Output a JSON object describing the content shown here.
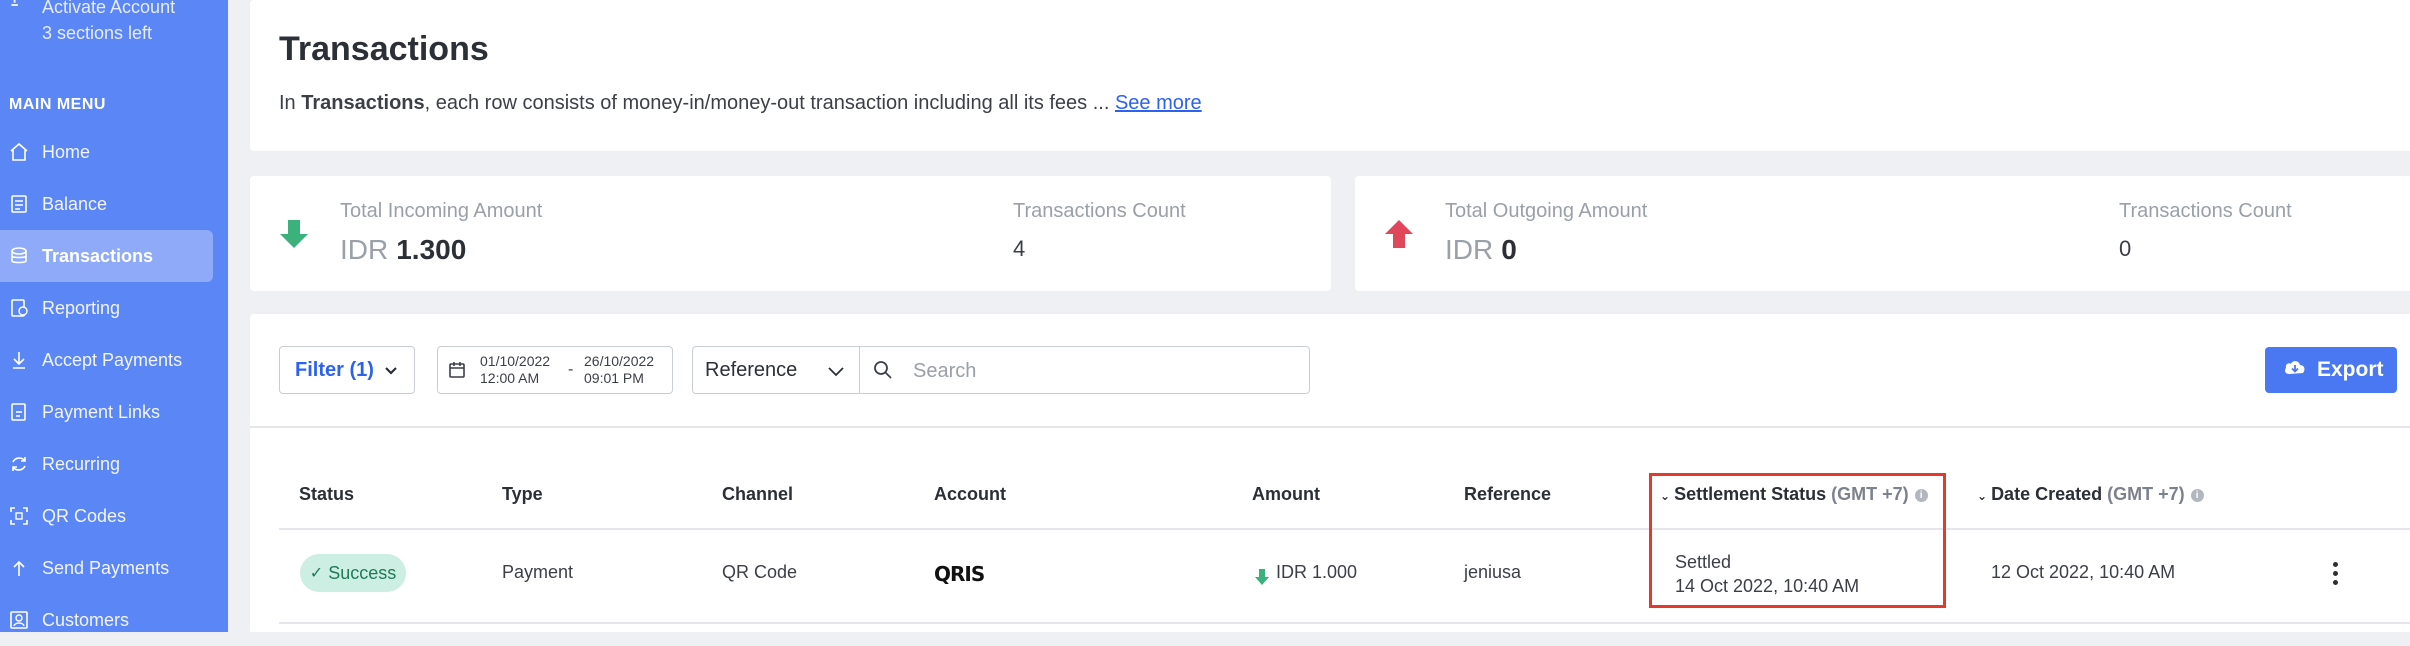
{
  "sidebar": {
    "activate": {
      "line1": "Activate Account",
      "line2": "3 sections left"
    },
    "menu_title": "MAIN MENU",
    "items": [
      {
        "label": "Home",
        "icon": "home-icon"
      },
      {
        "label": "Balance",
        "icon": "balance-icon"
      },
      {
        "label": "Transactions",
        "icon": "transactions-icon",
        "active": true
      },
      {
        "label": "Reporting",
        "icon": "reporting-icon"
      },
      {
        "label": "Accept Payments",
        "icon": "accept-payments-icon"
      },
      {
        "label": "Payment Links",
        "icon": "payment-links-icon"
      },
      {
        "label": "Recurring",
        "icon": "recurring-icon"
      },
      {
        "label": "QR Codes",
        "icon": "qr-code-icon"
      },
      {
        "label": "Send Payments",
        "icon": "send-payments-icon"
      },
      {
        "label": "Customers",
        "icon": "customers-icon"
      }
    ]
  },
  "header": {
    "title": "Transactions",
    "desc_prefix": "In ",
    "desc_bold": "Transactions",
    "desc_suffix": ", each row consists of money-in/money-out transaction including all its fees ... ",
    "see_more": "See more"
  },
  "summary": {
    "incoming": {
      "label": "Total Incoming Amount",
      "currency": "IDR",
      "amount": "1.300",
      "count_label": "Transactions Count",
      "count": "4"
    },
    "outgoing": {
      "label": "Total Outgoing Amount",
      "currency": "IDR",
      "amount": "0",
      "count_label": "Transactions Count",
      "count": "0"
    }
  },
  "toolbar": {
    "filter_label": "Filter (1)",
    "date_from": {
      "date": "01/10/2022",
      "time": "12:00 AM"
    },
    "date_to": {
      "date": "26/10/2022",
      "time": "09:01 PM"
    },
    "date_sep": "-",
    "search_field": "Reference",
    "search_placeholder": "Search",
    "export_label": "Export"
  },
  "table": {
    "columns": {
      "status": "Status",
      "type": "Type",
      "channel": "Channel",
      "account": "Account",
      "amount": "Amount",
      "reference": "Reference",
      "settlement": "Settlement Status",
      "settlement_tz": "(GMT +7)",
      "date_created": "Date Created",
      "date_tz": "(GMT +7)"
    },
    "rows": [
      {
        "status": "Success",
        "type": "Payment",
        "channel": "QR Code",
        "account": "QRIS",
        "amount": "IDR 1.000",
        "reference": "jeniusa",
        "settlement_status": "Settled",
        "settlement_date": "14 Oct 2022, 10:40 AM",
        "date_created": "12 Oct 2022, 10:40 AM"
      }
    ]
  },
  "colors": {
    "sidebar": "#5b86f6",
    "accent": "#2d62f0",
    "incoming": "#3bb27c",
    "outgoing": "#e0475a",
    "highlight": "#e23b2e",
    "success_bg": "#cdeee3"
  }
}
